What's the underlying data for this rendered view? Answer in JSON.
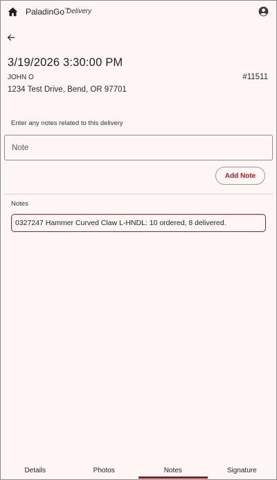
{
  "app": {
    "name": "PaladinGo",
    "trademark": "™",
    "subtitle": "Delivery"
  },
  "delivery": {
    "date": "3/19/2026 3:30:00 PM",
    "customer": "JOHN O",
    "order_number": "#11511",
    "address": "1234 Test Drive, Bend, OR 97701"
  },
  "note_form": {
    "prompt": "Enter any notes related to this delivery",
    "placeholder": "Note",
    "value": "",
    "add_label": "Add Note"
  },
  "notes": {
    "heading": "Notes",
    "items": [
      "0327247 Hammer Curved Claw L-HNDL: 10 ordered, 8 delivered."
    ]
  },
  "tabs": [
    {
      "label": "Details",
      "active": false
    },
    {
      "label": "Photos",
      "active": false
    },
    {
      "label": "Notes",
      "active": true
    },
    {
      "label": "Signature",
      "active": false
    }
  ],
  "colors": {
    "accent": "#a31e22",
    "background": "#fdf6f5"
  },
  "icons": [
    "home-icon",
    "account-icon",
    "back-arrow-icon"
  ]
}
